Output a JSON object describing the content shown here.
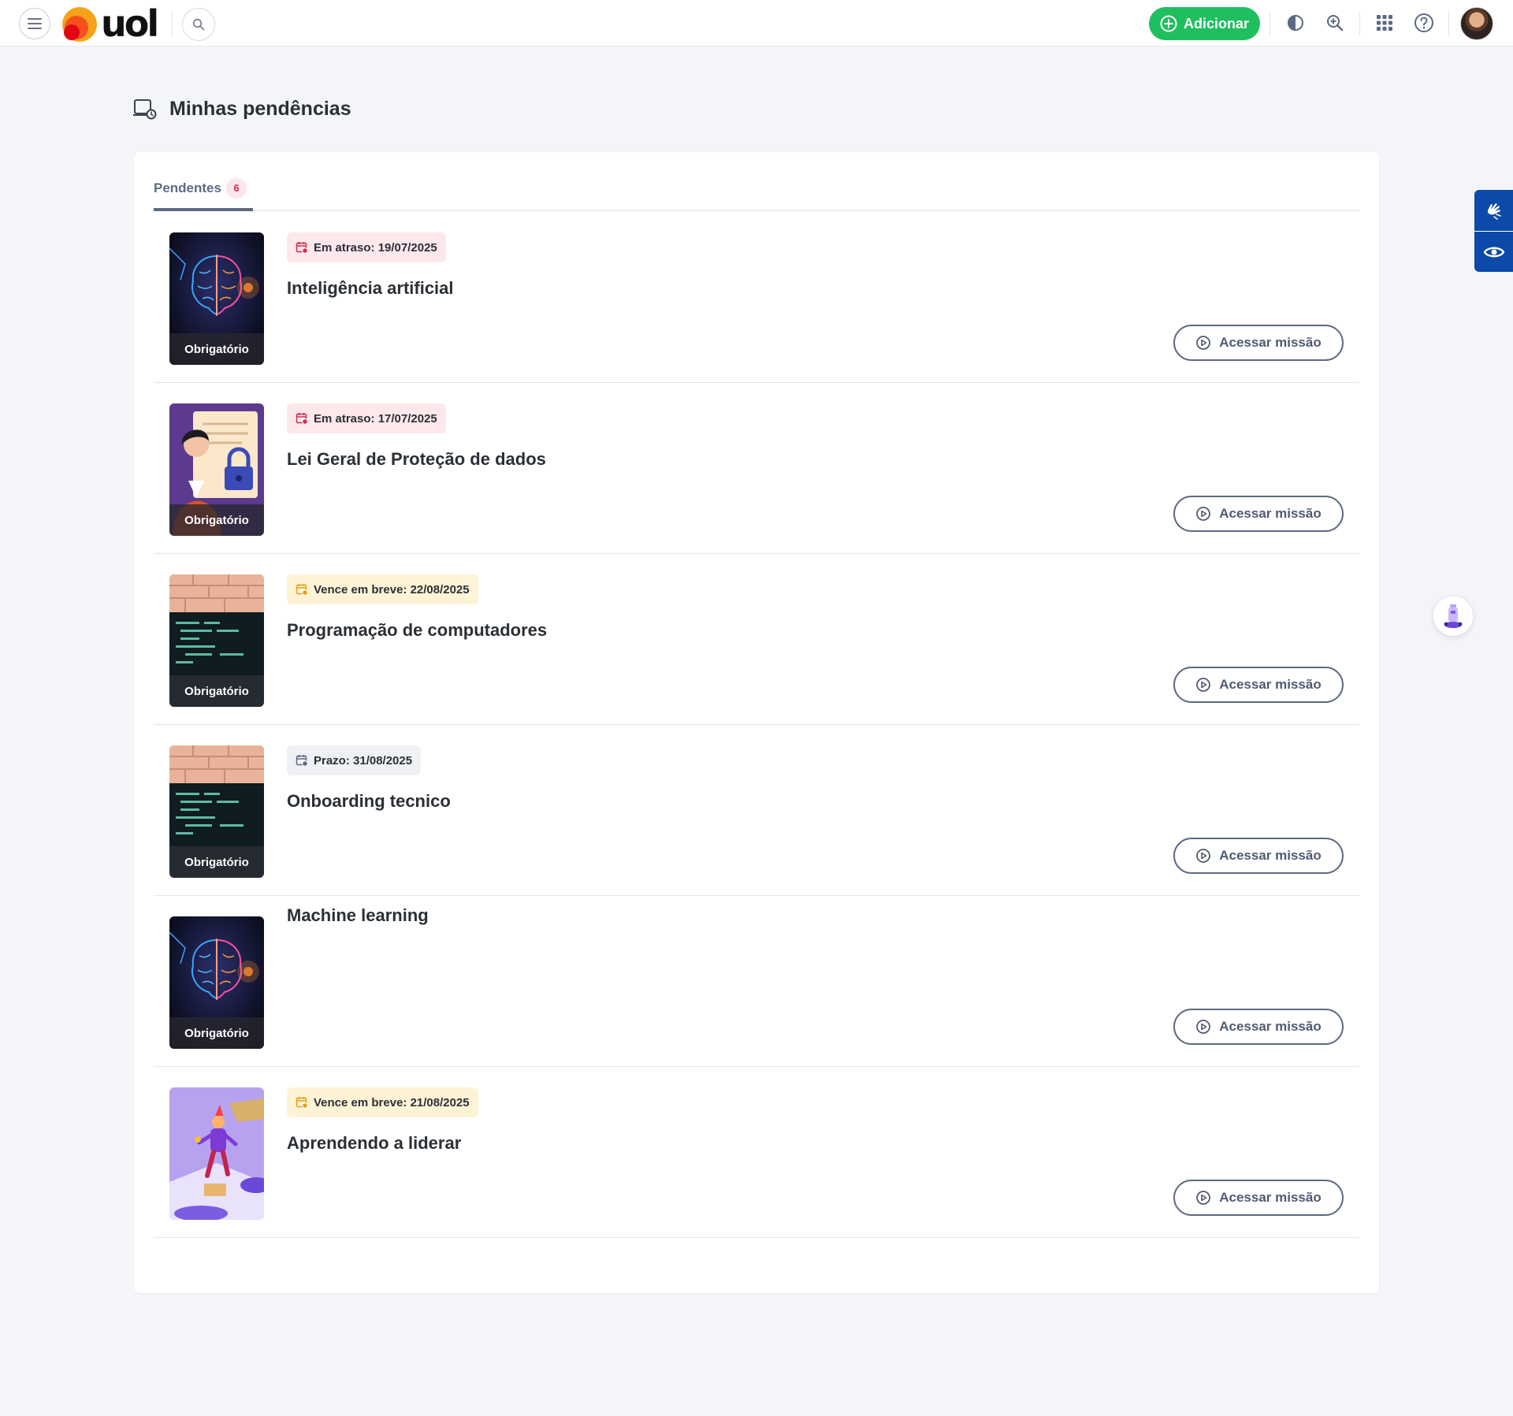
{
  "header": {
    "logo_text": "uol",
    "add_label": "Adicionar"
  },
  "page": {
    "title": "Minhas pendências"
  },
  "tabs": [
    {
      "label": "Pendentes",
      "count": "6"
    }
  ],
  "missions": [
    {
      "badge": "Em atraso: 19/07/2025",
      "badge_type": "overdue",
      "title": "Inteligência artificial",
      "tag": "Obrigatório",
      "image": "ai-brain",
      "action": "Acessar missão"
    },
    {
      "badge": "Em atraso: 17/07/2025",
      "badge_type": "overdue",
      "title": "Lei Geral de Proteção de dados",
      "tag": "Obrigatório",
      "image": "data-protection",
      "action": "Acessar missão"
    },
    {
      "badge": "Vence em breve: 22/08/2025",
      "badge_type": "soon",
      "title": "Programação de computadores",
      "tag": "Obrigatório",
      "image": "code-screen",
      "action": "Acessar missão"
    },
    {
      "badge": "Prazo: 31/08/2025",
      "badge_type": "deadline",
      "title": "Onboarding tecnico",
      "tag": "Obrigatório",
      "image": "code-screen",
      "action": "Acessar missão"
    },
    {
      "badge": "",
      "badge_type": "none",
      "title": "Machine learning",
      "tag": "Obrigatório",
      "image": "ai-brain",
      "action": "Acessar missão"
    },
    {
      "badge": "Vence em breve: 21/08/2025",
      "badge_type": "soon",
      "title": "Aprendendo a liderar",
      "tag": "",
      "image": "leader-3d",
      "action": "Acessar missão"
    }
  ],
  "colors": {
    "accent_green": "#1fbe5f",
    "overdue_bg": "#fde8ec",
    "soon_bg": "#fff3d6",
    "a11y_blue": "#0b4aa8",
    "button_outline": "#5d6a83"
  }
}
